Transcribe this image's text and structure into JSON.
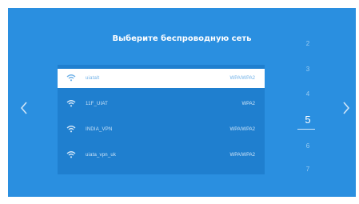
{
  "header": {
    "title": "Выберите беспроводную сеть"
  },
  "networks": [
    {
      "ssid": "uiatalt",
      "security": "WPA/WPA2",
      "selected": true
    },
    {
      "ssid": "11F_UIAT",
      "security": "WPA2",
      "selected": false
    },
    {
      "ssid": "INDIA_VPN",
      "security": "WPA/WPA2",
      "selected": false
    },
    {
      "ssid": "uiata_vpn_uk",
      "security": "WPA/WPA2",
      "selected": false
    }
  ],
  "pager": {
    "pages": [
      "2",
      "3",
      "4",
      "5",
      "6",
      "7"
    ],
    "current": "5"
  },
  "icons": {
    "prev": "chevron-left-icon",
    "next": "chevron-right-icon",
    "wifi": "wifi-icon"
  },
  "colors": {
    "background": "#2a8fe0",
    "list": "#1f7fcf",
    "selected_row": "#ffffff",
    "text": "#cfe5f8"
  }
}
